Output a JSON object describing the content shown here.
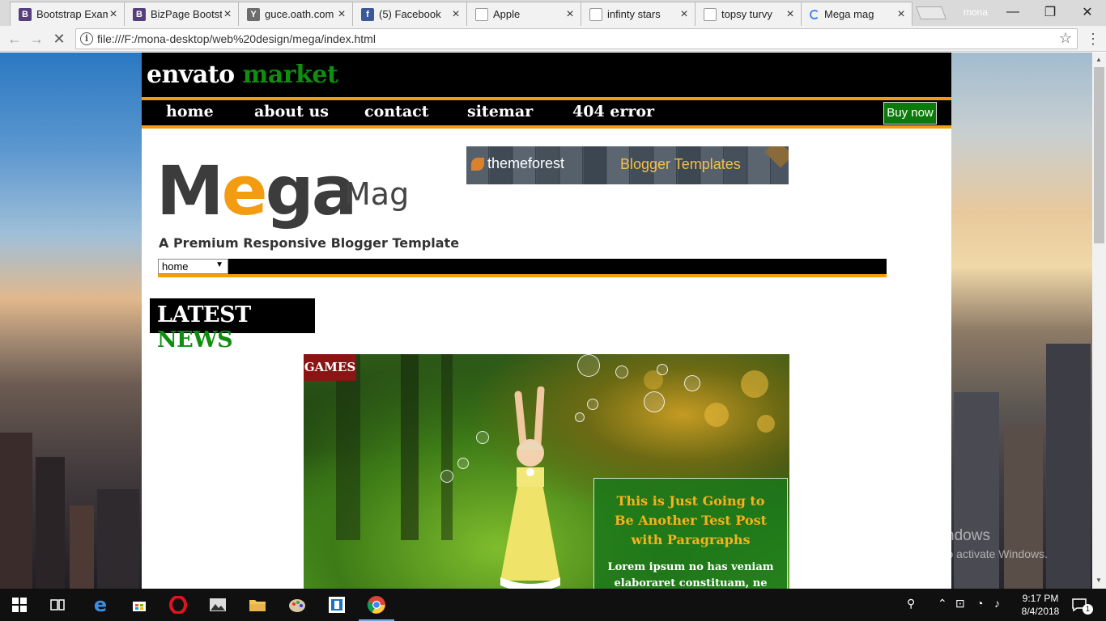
{
  "browser": {
    "tabs": [
      {
        "title": "Bootstrap Exam",
        "favicon_letter": "B",
        "favicon_color": "#563d7c"
      },
      {
        "title": "BizPage Bootstr",
        "favicon_letter": "B",
        "favicon_color": "#563d7c"
      },
      {
        "title": "guce.oath.com",
        "favicon_letter": "Y",
        "favicon_color": "#6d6d6d"
      },
      {
        "title": "(5) Facebook",
        "favicon_letter": "f",
        "favicon_color": "#3b5998"
      },
      {
        "title": "Apple",
        "favicon_letter": "",
        "favicon_color": "#ffffff"
      },
      {
        "title": "infinty stars",
        "favicon_letter": "",
        "favicon_color": "#ffffff"
      },
      {
        "title": "topsy turvy",
        "favicon_letter": "",
        "favicon_color": "#ffffff"
      },
      {
        "title": "Mega mag",
        "favicon_letter": "",
        "favicon_color": "#ffffff",
        "active": true
      }
    ],
    "profile_name": "mona",
    "url": "file:///F:/mona-desktop/web%20design/mega/index.html"
  },
  "site": {
    "brand_part1": "envato",
    "brand_part2": "market",
    "nav": [
      "home",
      "about us",
      "contact",
      "sitemar",
      "404 error"
    ],
    "buy_now": "Buy now",
    "logo_main_prefix": "M",
    "logo_main_accent": "e",
    "logo_main_suffix": "ga",
    "logo_sub": "Mag",
    "tagline": "A Premium Responsive Blogger Template",
    "ad_left": "themeforest",
    "ad_right": "Blogger Templates",
    "select_value": "home",
    "latest_part1": "LATEST",
    "latest_part2": "NEWS",
    "feature_category": "GAMES",
    "feature_title": "This is Just Going to Be Another Test Post with Paragraphs",
    "feature_excerpt": "Lorem ipsum no has veniam elaboraret constituam, ne nibh"
  },
  "os": {
    "activate_title": "Activate Windows",
    "activate_sub": "Go to Settings to activate Windows.",
    "time": "9:17 PM",
    "date": "8/4/2018",
    "notification_count": "1"
  },
  "colors": {
    "accent_orange": "#f39c12",
    "brand_green": "#0e8f0e",
    "category_red": "#8b1414"
  }
}
